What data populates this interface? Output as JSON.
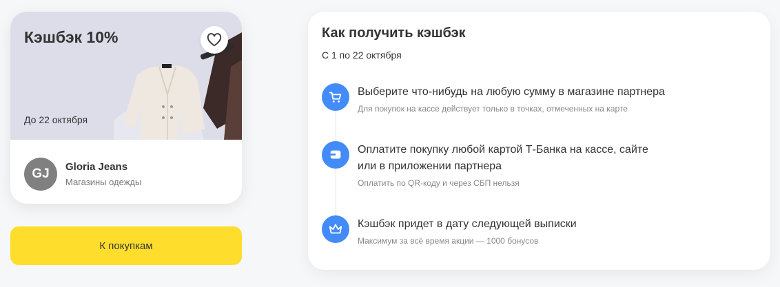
{
  "offer": {
    "cashback_title": "Кэшбэк 10%",
    "deadline": "До 22 октября",
    "brand_initials": "GJ",
    "brand_name": "Gloria Jeans",
    "brand_category": "Магазины одежды"
  },
  "cta": {
    "label": "К покупкам"
  },
  "howto": {
    "title": "Как получить кэшбэк",
    "period": "С 1 по 22 октября",
    "steps": [
      {
        "icon": "cart-icon",
        "title_lines": [
          "Выберите что-нибудь на любую сумму в магазине партнера"
        ],
        "note": "Для покупок на кассе действует только в точках, отмеченных на карте"
      },
      {
        "icon": "card-icon",
        "title_lines": [
          "Оплатите покупку любой картой Т-Банка на кассе, сайте",
          "или в приложении партнера"
        ],
        "note": "Оплатить по QR-коду и через СБП нельзя"
      },
      {
        "icon": "crown-icon",
        "title_lines": [
          "Кэшбэк придет в дату следующей выписки"
        ],
        "note": "Максимум за всё время акции — 1000 бонусов"
      }
    ]
  },
  "colors": {
    "accent_yellow": "#ffdd2d",
    "icon_blue": "#428bf9",
    "banner_bg": "#dcdde9",
    "avatar_gray": "#808080"
  }
}
